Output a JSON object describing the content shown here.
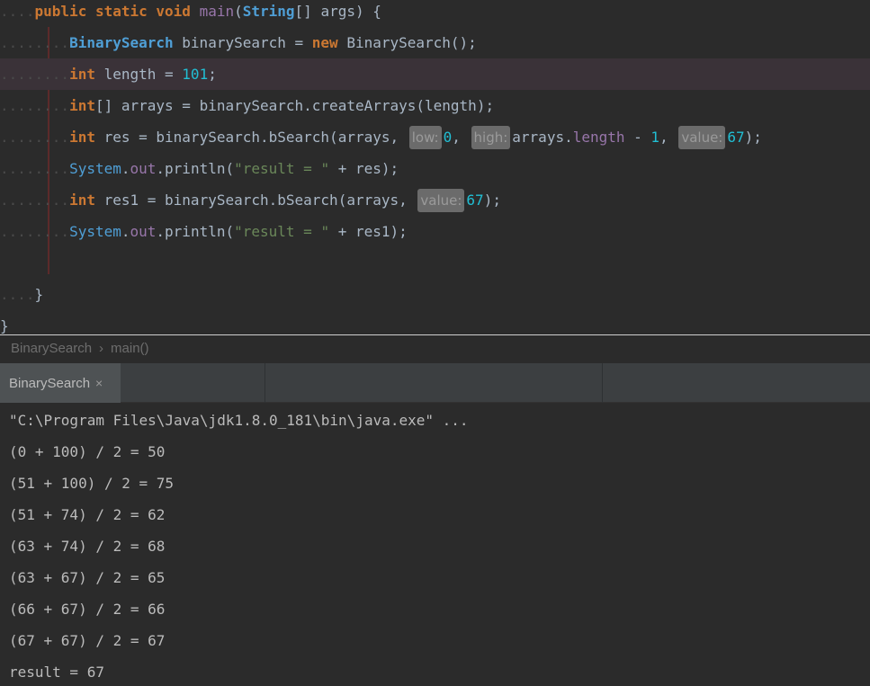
{
  "editor": {
    "lines": [
      {
        "indent": "....",
        "tokens": [
          {
            "t": "public",
            "c": "kw"
          },
          {
            "t": " ",
            "c": "plain"
          },
          {
            "t": "static",
            "c": "kw"
          },
          {
            "t": " ",
            "c": "plain"
          },
          {
            "t": "void",
            "c": "kw"
          },
          {
            "t": " ",
            "c": "plain"
          },
          {
            "t": "main",
            "c": "fn"
          },
          {
            "t": "(",
            "c": "plain"
          },
          {
            "t": "String",
            "c": "cls-b"
          },
          {
            "t": "[] args) {",
            "c": "plain"
          }
        ]
      },
      {
        "indent": "........",
        "tokens": [
          {
            "t": "BinarySearch",
            "c": "cls-b"
          },
          {
            "t": " binarySearch = ",
            "c": "plain"
          },
          {
            "t": "new",
            "c": "kw"
          },
          {
            "t": " BinarySearch();",
            "c": "plain"
          }
        ]
      },
      {
        "indent": "........",
        "current": true,
        "tokens": [
          {
            "t": "int",
            "c": "kw"
          },
          {
            "t": " length = ",
            "c": "plain"
          },
          {
            "t": "101",
            "c": "num"
          },
          {
            "t": ";",
            "c": "plain"
          }
        ]
      },
      {
        "indent": "........",
        "tokens": [
          {
            "t": "int",
            "c": "kw"
          },
          {
            "t": "[] arrays = binarySearch.createArrays(length);",
            "c": "plain"
          }
        ]
      },
      {
        "indent": "........",
        "tokens": [
          {
            "t": "int",
            "c": "kw"
          },
          {
            "t": " res = binarySearch.bSearch(arrays, ",
            "c": "plain"
          },
          {
            "t": "low:",
            "c": "hint"
          },
          {
            "t": "0",
            "c": "num"
          },
          {
            "t": ", ",
            "c": "plain"
          },
          {
            "t": "high:",
            "c": "hint"
          },
          {
            "t": "arrays.",
            "c": "plain"
          },
          {
            "t": "length",
            "c": "field"
          },
          {
            "t": " - ",
            "c": "plain"
          },
          {
            "t": "1",
            "c": "num"
          },
          {
            "t": ", ",
            "c": "plain"
          },
          {
            "t": "value:",
            "c": "hint"
          },
          {
            "t": "67",
            "c": "num"
          },
          {
            "t": ");",
            "c": "plain"
          }
        ]
      },
      {
        "indent": "........",
        "tokens": [
          {
            "t": "System",
            "c": "cls"
          },
          {
            "t": ".",
            "c": "plain"
          },
          {
            "t": "out",
            "c": "field"
          },
          {
            "t": ".println(",
            "c": "plain"
          },
          {
            "t": "\"result = \"",
            "c": "str"
          },
          {
            "t": " + res);",
            "c": "plain"
          }
        ]
      },
      {
        "indent": "........",
        "tokens": [
          {
            "t": "int",
            "c": "kw"
          },
          {
            "t": " res1 = binarySearch.bSearch(arrays, ",
            "c": "plain"
          },
          {
            "t": "value:",
            "c": "hint"
          },
          {
            "t": "67",
            "c": "num"
          },
          {
            "t": ");",
            "c": "plain"
          }
        ]
      },
      {
        "indent": "........",
        "tokens": [
          {
            "t": "System",
            "c": "cls"
          },
          {
            "t": ".",
            "c": "plain"
          },
          {
            "t": "out",
            "c": "field"
          },
          {
            "t": ".println(",
            "c": "plain"
          },
          {
            "t": "\"result = \"",
            "c": "str"
          },
          {
            "t": " + res1);",
            "c": "plain"
          }
        ]
      },
      {
        "indent": "",
        "tokens": []
      },
      {
        "indent": "....",
        "tokens": [
          {
            "t": "}",
            "c": "plain"
          }
        ]
      },
      {
        "indent": "",
        "tokens": [
          {
            "t": "}",
            "c": "plain"
          }
        ]
      }
    ]
  },
  "breadcrumb": {
    "class_name": "BinarySearch",
    "separator": "›",
    "method": "main()"
  },
  "run_panel": {
    "tab_label": "BinarySearch",
    "close_glyph": "×"
  },
  "console": {
    "lines": [
      "\"C:\\Program Files\\Java\\jdk1.8.0_181\\bin\\java.exe\" ...",
      "(0 + 100) / 2 = 50",
      "(51 + 100) / 2 = 75",
      "(51 + 74) / 2 = 62",
      "(63 + 74) / 2 = 68",
      "(63 + 67) / 2 = 65",
      "(66 + 67) / 2 = 66",
      "(67 + 67) / 2 = 67",
      "result = 67"
    ]
  },
  "colors": {
    "editor_bg": "#2b2b2b",
    "keyword": "#cc7832",
    "number": "#21bfd4",
    "string": "#6a8759",
    "class": "#4f9fd6",
    "field": "#9876aa"
  }
}
